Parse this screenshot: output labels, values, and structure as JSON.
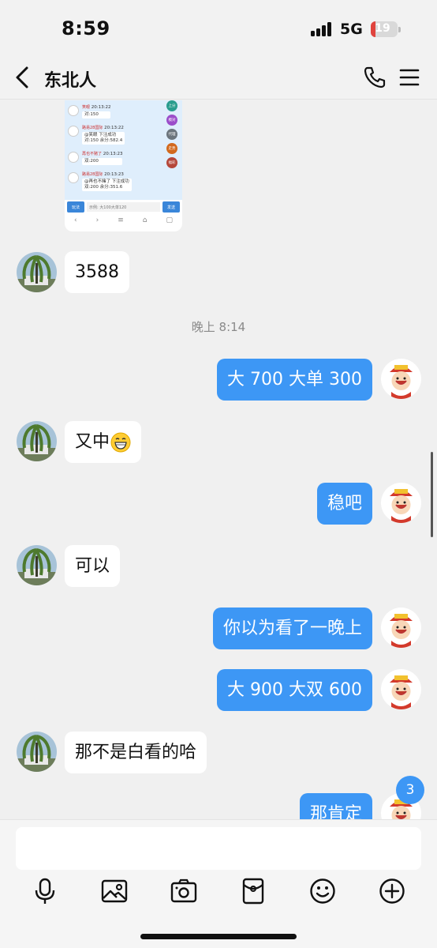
{
  "status_bar": {
    "time": "8:59",
    "network": "5G",
    "battery": "19",
    "battery_level": 0.19
  },
  "header": {
    "title": "东北人",
    "back_icon": "chevron-left-icon",
    "call_icon": "phone-icon",
    "menu_icon": "hamburger-menu-icon"
  },
  "shared_screenshot": {
    "messages": [
      {
        "name": "笑眼",
        "time": "20:13:22",
        "text": "对:150"
      },
      {
        "name": "路易28国际",
        "time": "20:13:22",
        "text": "@笑眼 下注成功",
        "text2": "对:150 余分:582.4"
      },
      {
        "name": "再也不赌了",
        "time": "20:13:23",
        "text": "双:200"
      },
      {
        "name": "路易28国际",
        "time": "20:13:23",
        "text": "@再也不赌了 下注成功",
        "text2": "双:200 余分:351.6"
      }
    ],
    "side_buttons": [
      "上分",
      "模对",
      "代理",
      "走势",
      "福彩"
    ],
    "left_button": "玩法",
    "input_placeholder": "示例: 大100大单120",
    "send_button": "发送"
  },
  "messages": [
    {
      "side": "left",
      "text": "3588"
    },
    {
      "side": "right",
      "text": "大 700 大单 300"
    },
    {
      "side": "left",
      "text": "又中",
      "emoji": "grinning-face-emoji"
    },
    {
      "side": "right",
      "text": "稳吧"
    },
    {
      "side": "left",
      "text": "可以"
    },
    {
      "side": "right",
      "text": "你以为看了一晚上"
    },
    {
      "side": "right",
      "text": "大 900 大双 600"
    },
    {
      "side": "left",
      "text": "那不是白看的哈"
    },
    {
      "side": "right",
      "text": "那肯定"
    }
  ],
  "timestamp": "晚上 8:14",
  "unread_count": "3",
  "composer": {
    "placeholder": "",
    "tools": [
      "microphone-icon",
      "image-icon",
      "camera-icon",
      "red-packet-icon",
      "emoji-icon",
      "add-icon"
    ]
  },
  "colors": {
    "accent": "#3d97f5",
    "background": "#f0f0f0",
    "bubble_left": "#ffffff"
  }
}
